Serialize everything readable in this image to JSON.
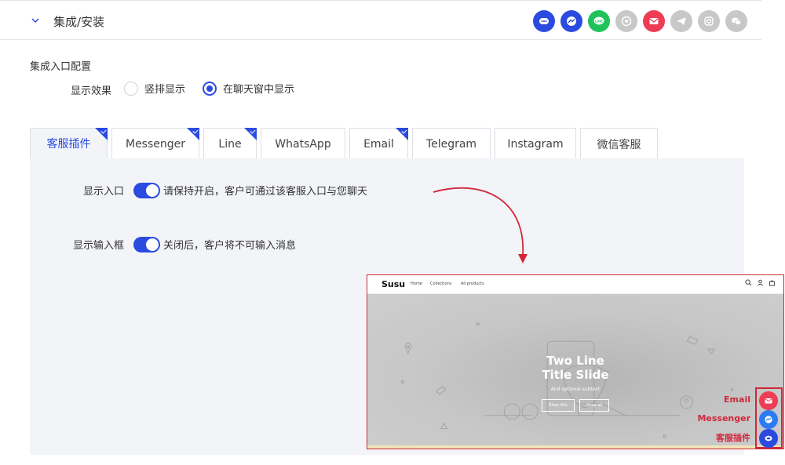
{
  "section": {
    "title": "集成/安装",
    "channel_icons": [
      {
        "name": "chat-widget-icon",
        "color": "#2b4be0",
        "enabled": true
      },
      {
        "name": "messenger-icon",
        "color": "#2b4be0",
        "enabled": true
      },
      {
        "name": "line-icon",
        "color": "#1fc35a",
        "enabled": true
      },
      {
        "name": "whatsapp-icon",
        "color": "#c8c8c8",
        "enabled": false
      },
      {
        "name": "email-icon",
        "color": "#ee3c55",
        "enabled": true
      },
      {
        "name": "telegram-icon",
        "color": "#c8c8c8",
        "enabled": false
      },
      {
        "name": "instagram-icon",
        "color": "#c8c8c8",
        "enabled": false
      },
      {
        "name": "wechat-icon",
        "color": "#c8c8c8",
        "enabled": false
      }
    ]
  },
  "config": {
    "heading": "集成入口配置",
    "display_effect_label": "显示效果",
    "options": [
      "竖排显示",
      "在聊天窗中显示"
    ],
    "selected_option": "在聊天窗中显示"
  },
  "tabs": [
    {
      "label": "客服插件",
      "active": true,
      "configured": true
    },
    {
      "label": "Messenger",
      "active": false,
      "configured": true
    },
    {
      "label": "Line",
      "active": false,
      "configured": true
    },
    {
      "label": "WhatsApp",
      "active": false,
      "configured": false
    },
    {
      "label": "Email",
      "active": false,
      "configured": true
    },
    {
      "label": "Telegram",
      "active": false,
      "configured": false
    },
    {
      "label": "Instagram",
      "active": false,
      "configured": false
    },
    {
      "label": "微信客服",
      "active": false,
      "configured": false
    }
  ],
  "panel": {
    "show_entry_label": "显示入口",
    "show_entry_on": true,
    "show_entry_desc": "请保持开启，客户可通过该客服入口与您聊天",
    "show_input_label": "显示输入框",
    "show_input_on": true,
    "show_input_desc": "关闭后，客户将不可输入消息"
  },
  "preview": {
    "logo": "Susu",
    "nav_links": [
      "Home",
      "Collections",
      "All products"
    ],
    "hero_title": "Two Line Title Slide",
    "hero_subtitle": "And optional subtext",
    "buttons": [
      "Shop this",
      "Shop all"
    ],
    "widget_labels": [
      "Email",
      "Messenger",
      "客服插件"
    ],
    "accent_color": "#d0273a"
  }
}
